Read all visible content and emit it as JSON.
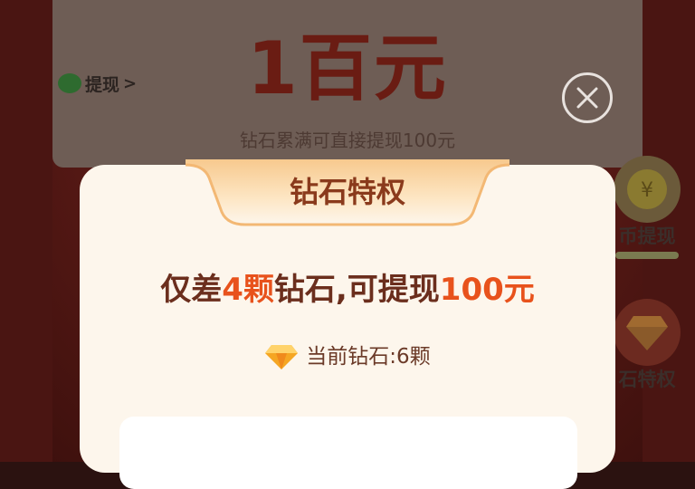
{
  "background": {
    "big_title": "1百元",
    "subtitle": "钻石累满可直接提现100元",
    "withdraw_label": "提现",
    "withdraw_chevron": ">"
  },
  "side": {
    "coin_label": "币提现",
    "diamond_label": "石特权",
    "coin_glyph": "¥"
  },
  "modal": {
    "ribbon_title": "钻石特权",
    "headline_prefix": "仅差",
    "headline_count": "4颗",
    "headline_mid": "钻石,可提现",
    "headline_amount": "100元",
    "current_label": "当前钻石:6颗"
  },
  "icons": {
    "close": "close-icon",
    "wechat": "wechat-icon",
    "diamond": "diamond-icon",
    "coin": "coin-icon"
  },
  "colors": {
    "accent": "#e8521c",
    "modal_bg": "#fdf6ec",
    "ribbon_text": "#8a3a1c"
  }
}
